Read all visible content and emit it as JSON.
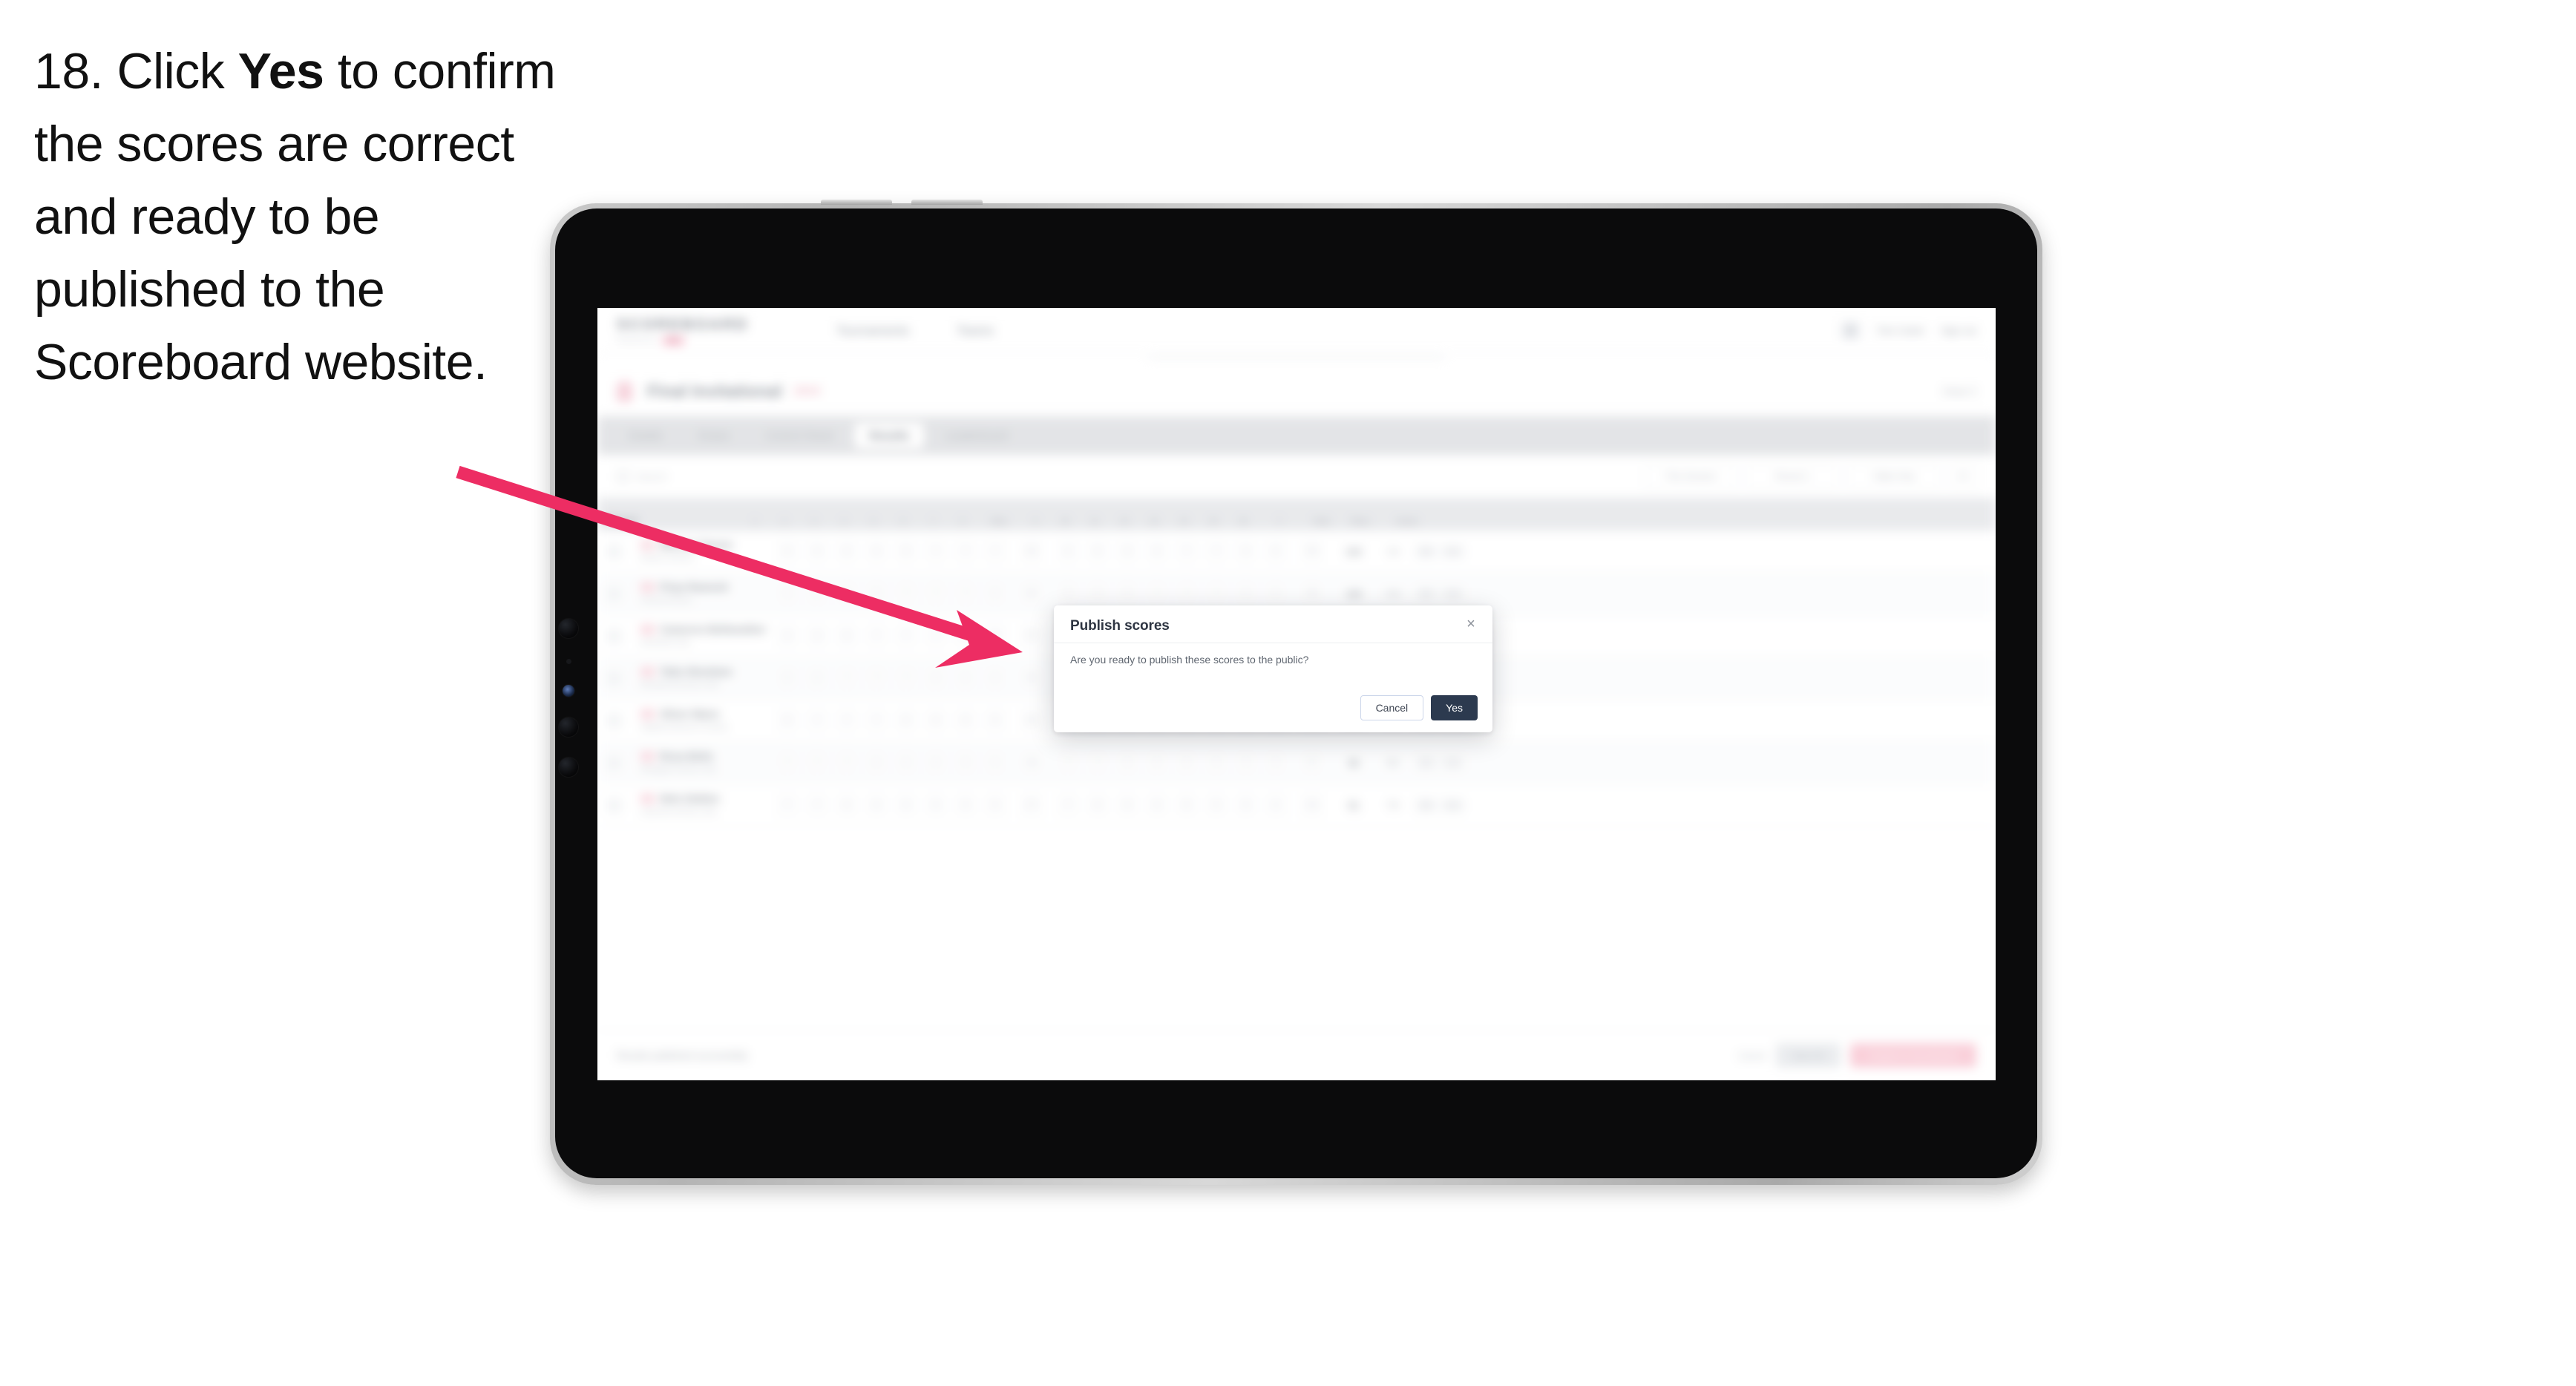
{
  "instruction": {
    "number": "18.",
    "lead": "Click",
    "emphasis": "Yes",
    "rest": "to confirm the scores are correct and ready to be published to the Scoreboard website."
  },
  "annotation": {
    "arrow_color": "#ED2D63",
    "arrow_name": "pointer-arrow"
  },
  "device": {
    "name": "tablet",
    "frame_color": "#BDBDBD",
    "screen_color": "#0B0B0C"
  },
  "app": {
    "header": {
      "brand": "SCOREBOARD",
      "brand_sub": "Powered by",
      "brand_pill": "PRO",
      "nav": [
        {
          "label": "Tournaments"
        },
        {
          "label": "Teams"
        }
      ],
      "user_name": "Tom Carter",
      "signout_label": "Sign out"
    },
    "event": {
      "title": "Final Invitational",
      "badge": "2024",
      "action_label": "Close X"
    },
    "tabs": [
      {
        "label": "Details"
      },
      {
        "label": "Draws"
      },
      {
        "label": "Control Sheet"
      },
      {
        "label": "Results"
      },
      {
        "label": "Leaderboard"
      }
    ],
    "active_tab_index": 3,
    "filters": {
      "search_placeholder": "Search",
      "controls": [
        {
          "label": "This Session"
        },
        {
          "label": "Round 1"
        },
        {
          "label": "Table Only"
        },
        {
          "label": "⚙"
        }
      ]
    },
    "table": {
      "columns": [
        "Player",
        "1",
        "2",
        "3",
        "4",
        "5",
        "6",
        "7",
        "8",
        "Shot",
        "9",
        "10",
        "11",
        "12",
        "13",
        "14",
        "15",
        "16",
        "T",
        "Total",
        "Place",
        "Action"
      ],
      "rows": [
        {
          "name": "Marcus Tanner",
          "club": "Eastern Archery",
          "scores": [
            "9",
            "9",
            "8",
            "8",
            "8",
            "7",
            "7",
            "7",
            "63",
            "9",
            "8",
            "8",
            "8",
            "7",
            "7",
            "6",
            "6",
            "59"
          ],
          "total": "122",
          "place": "1st",
          "actions": [
            "Edit",
            "Void"
          ]
        },
        {
          "name": "Priya Ramesh",
          "club": "Summit Archers",
          "scores": [
            "9",
            "8",
            "8",
            "8",
            "7",
            "7",
            "7",
            "6",
            "60",
            "9",
            "8",
            "8",
            "7",
            "7",
            "7",
            "6",
            "6",
            "58"
          ],
          "total": "118",
          "place": "2nd",
          "actions": [
            "Edit",
            "Void"
          ]
        },
        {
          "name": "Cameron Bellweather",
          "club": "Northside Club",
          "scores": [
            "8",
            "8",
            "8",
            "7",
            "7",
            "7",
            "6",
            "6",
            "57",
            "8",
            "8",
            "7",
            "7",
            "7",
            "6",
            "6",
            "6",
            "55"
          ],
          "total": "112",
          "place": "3rd",
          "actions": [
            "Edit",
            "Void"
          ]
        },
        {
          "name": "Talia Okonkwo",
          "club": "Riverbend Archery Club",
          "scores": [
            "8",
            "8",
            "7",
            "7",
            "7",
            "6",
            "6",
            "6",
            "55",
            "8",
            "7",
            "7",
            "7",
            "6",
            "6",
            "6",
            "5",
            "52"
          ],
          "total": "107",
          "place": "4th",
          "actions": [
            "Edit",
            "Void"
          ]
        },
        {
          "name": "Oliver Mann",
          "club": "Highland Bowmen Society",
          "scores": [
            "8",
            "7",
            "7",
            "7",
            "6",
            "6",
            "6",
            "5",
            "52",
            "7",
            "7",
            "7",
            "6",
            "6",
            "6",
            "5",
            "5",
            "49"
          ],
          "total": "101",
          "place": "5th",
          "actions": [
            "Edit",
            "Void"
          ]
        },
        {
          "name": "Rosa Belin",
          "club": "Westgate Archery Club",
          "scores": [
            "7",
            "7",
            "7",
            "6",
            "6",
            "6",
            "5",
            "5",
            "49",
            "7",
            "7",
            "6",
            "6",
            "6",
            "5",
            "5",
            "5",
            "47"
          ],
          "total": "96",
          "place": "6th",
          "actions": [
            "Edit",
            "Void"
          ]
        },
        {
          "name": "Nels Dahlen",
          "club": "Lakeview Archery Club",
          "scores": [
            "7",
            "7",
            "6",
            "6",
            "6",
            "5",
            "5",
            "5",
            "47",
            "7",
            "6",
            "6",
            "6",
            "5",
            "5",
            "5",
            "4",
            "44"
          ],
          "total": "91",
          "place": "7th",
          "actions": [
            "Edit",
            "Void"
          ]
        }
      ]
    },
    "footer": {
      "note": "Results published successfully",
      "link": "Cancel",
      "secondary_label": "Save All",
      "primary_label": "Publish to Scoreboard"
    }
  },
  "modal": {
    "title": "Publish scores",
    "body": "Are you ready to publish these scores to the public?",
    "cancel_label": "Cancel",
    "confirm_label": "Yes",
    "close_icon": "×",
    "confirm_color": "#2C3A4F"
  }
}
